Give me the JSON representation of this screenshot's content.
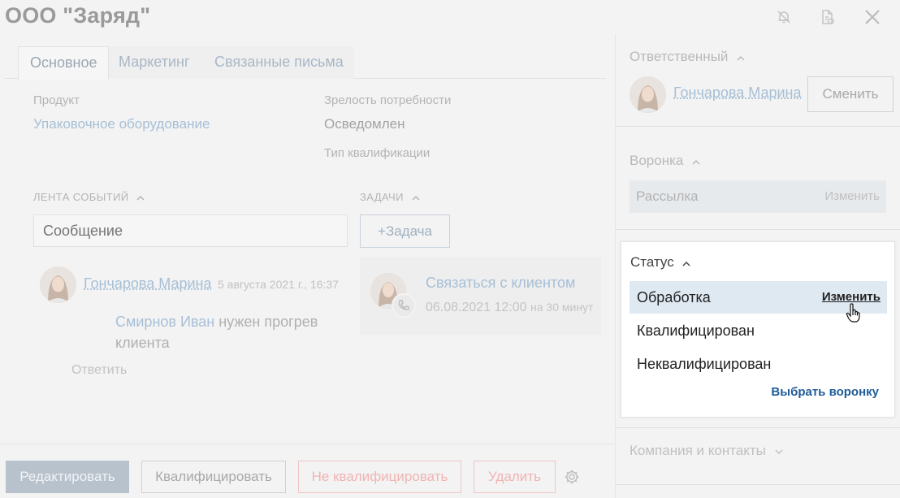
{
  "header": {
    "title": "ООО \"Заряд\""
  },
  "tabs": [
    {
      "label": "Основное",
      "active": true
    },
    {
      "label": "Маркетинг",
      "active": false
    },
    {
      "label": "Связанные письма",
      "active": false
    }
  ],
  "fields": {
    "product_label": "Продукт",
    "product_value": "Упаковочное оборудование",
    "maturity_label": "Зрелость потребности",
    "maturity_value": "Осведомлен",
    "qual_type_label": "Тип квалификации"
  },
  "feed": {
    "title": "ЛЕНТА СОБЫТИЙ",
    "input_placeholder": "Сообщение",
    "author": "Гончарова Марина",
    "date": "5 августа 2021 г., 16:37",
    "mention": "Смирнов Иван",
    "text_line1": "нужен прогрев",
    "text_line2": "клиента",
    "reply": "Ответить"
  },
  "tasks": {
    "title": "ЗАДАЧИ",
    "add_button": "+Задача",
    "task_title": "Связаться с клиентом",
    "task_datetime": "06.08.2021 12:00",
    "task_duration": "на 30 минут"
  },
  "sidebar": {
    "responsible": {
      "title": "Ответственный",
      "person": "Гончарова Марина",
      "change_button": "Сменить"
    },
    "funnel": {
      "title": "Воронка",
      "value": "Рассылка",
      "change_link": "Изменить"
    },
    "status": {
      "title": "Статус",
      "options": [
        "Обработка",
        "Квалифицирован",
        "Неквалифицирован"
      ],
      "change_link": "Изменить",
      "select_funnel_link": "Выбрать воронку"
    },
    "contacts": {
      "title": "Компания и контакты"
    }
  },
  "footer": {
    "edit": "Редактировать",
    "qualify": "Квалифицировать",
    "disqualify": "Не квалифицировать",
    "delete": "Удалить"
  },
  "colors": {
    "accent": "#1f5c99",
    "selected_row": "#dfe9f2",
    "danger_faded": "#f1b3b3"
  }
}
